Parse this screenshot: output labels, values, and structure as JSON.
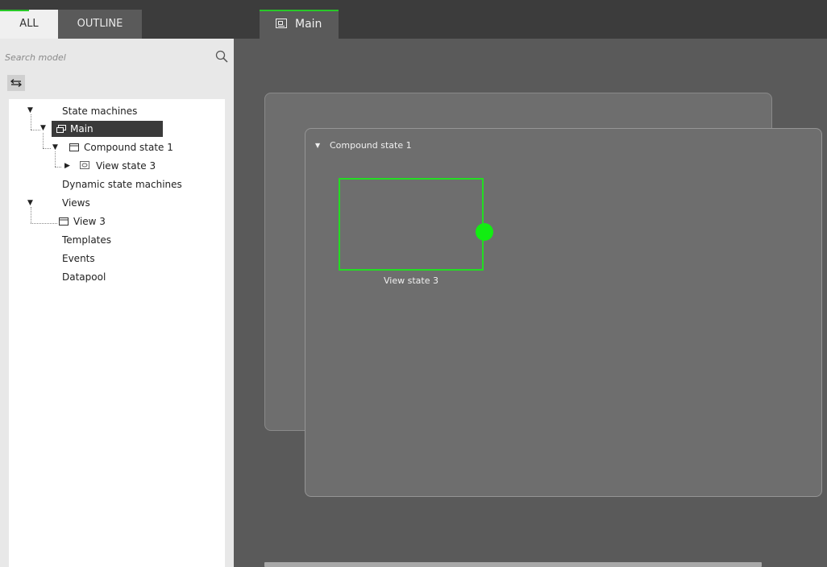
{
  "left_tabs": [
    {
      "label": "ALL",
      "active": true
    },
    {
      "label": "OUTLINE",
      "active": false
    }
  ],
  "search": {
    "placeholder": "Search model",
    "value": "",
    "icon": "search-icon"
  },
  "sync_button": {
    "icon": "sync-arrows-icon"
  },
  "tree": {
    "state_machines": "State machines",
    "main": "Main",
    "compound_state": "Compound state 1",
    "view_state": "View state 3",
    "dynamic_state_machines": "Dynamic state machines",
    "views": "Views",
    "view3": "View 3",
    "templates": "Templates",
    "events": "Events",
    "datapool": "Datapool"
  },
  "editor_tab": {
    "label": "Main",
    "icon": "state-machine-icon"
  },
  "canvas": {
    "compound_state_label": "Compound state 1",
    "view_state_label": "View state 3"
  },
  "colors": {
    "accent": "#28c828",
    "selection": "#22dd22",
    "tree_selected_bg": "#3a3a3a"
  }
}
